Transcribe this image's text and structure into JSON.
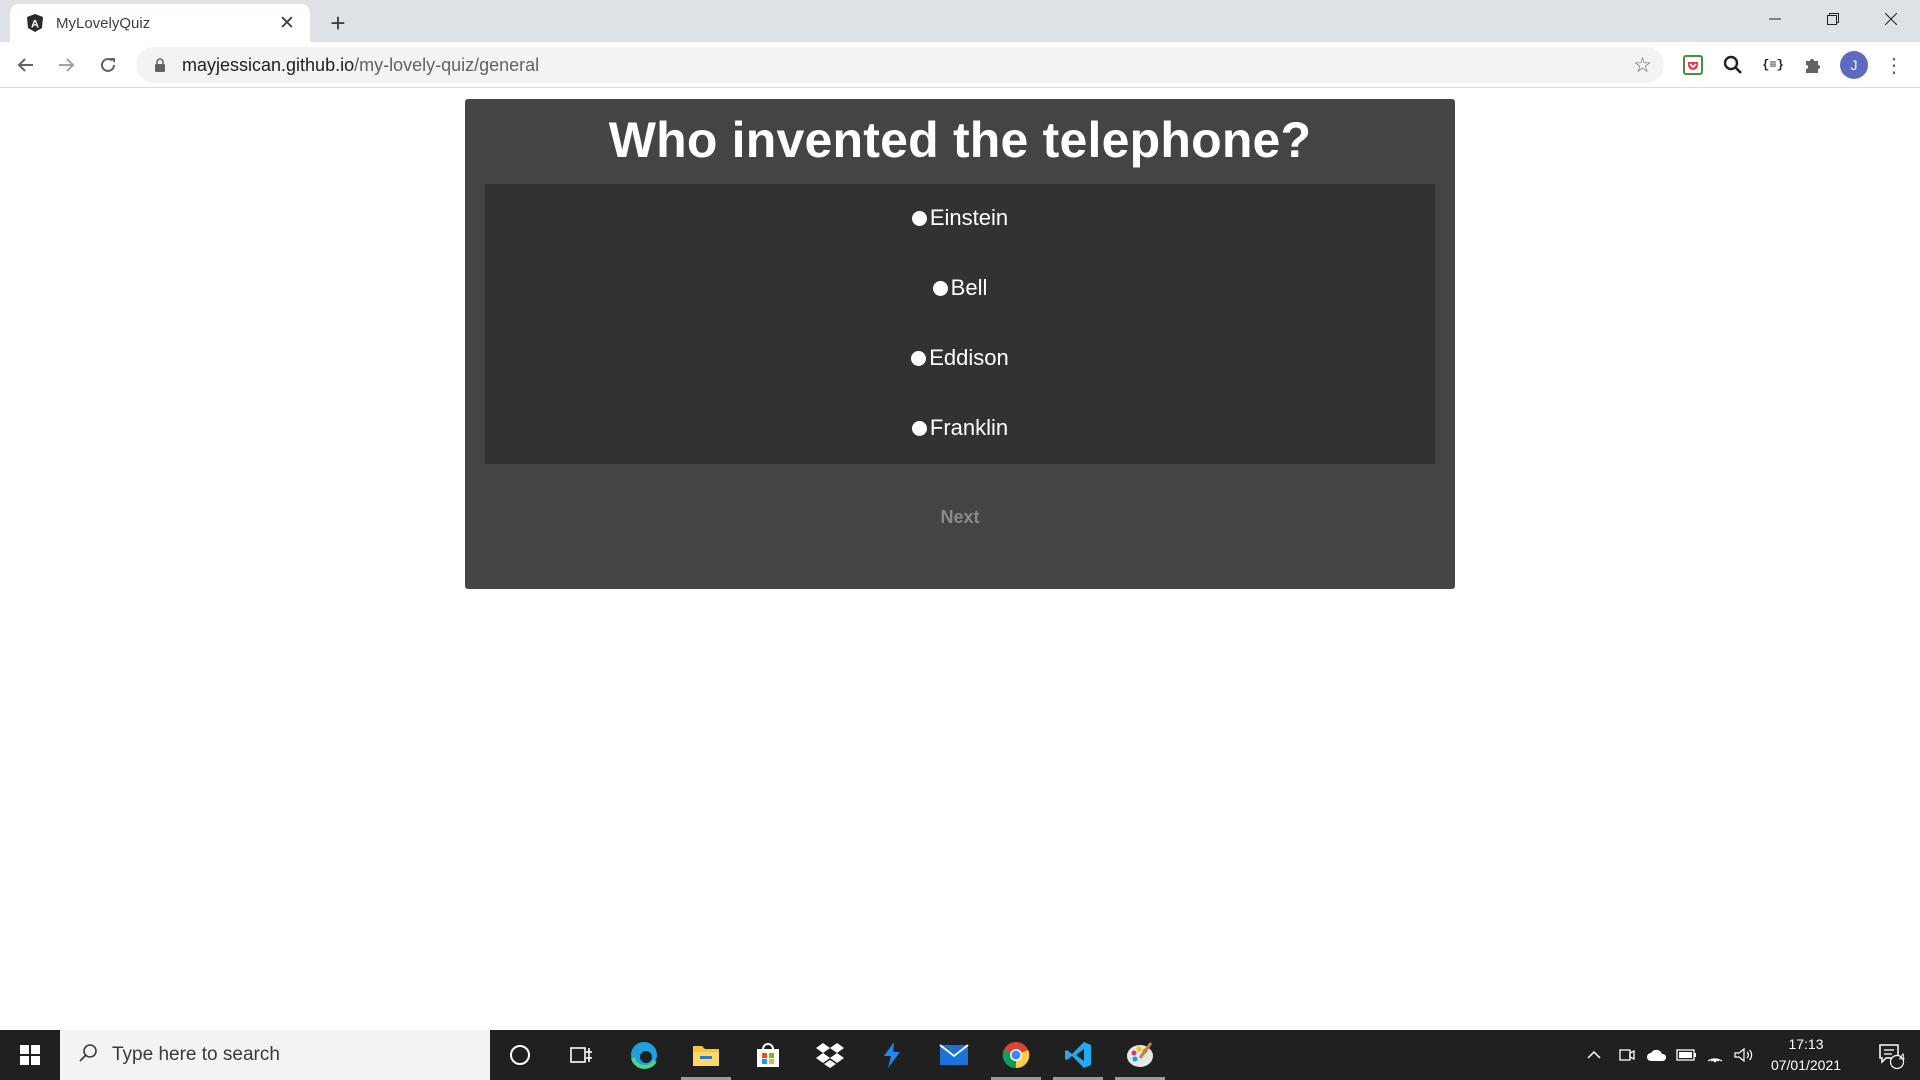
{
  "browser": {
    "tab_title": "MyLovelyQuiz",
    "tab_close": "✕",
    "new_tab": "+",
    "url_host": "mayjessican.github.io",
    "url_path": "/my-lovely-quiz/general",
    "avatar_letter": "J"
  },
  "quiz": {
    "question": "Who invented the telephone?",
    "answers": [
      "Einstein",
      "Bell",
      "Eddison",
      "Franklin"
    ],
    "next_label": "Next"
  },
  "taskbar": {
    "search_placeholder": "Type here to search",
    "time": "17:13",
    "date": "07/01/2021",
    "notification_count": "4"
  },
  "colors": {
    "card_bg": "#444444",
    "answers_bg": "#323232",
    "next_text": "#8a8a8a"
  }
}
